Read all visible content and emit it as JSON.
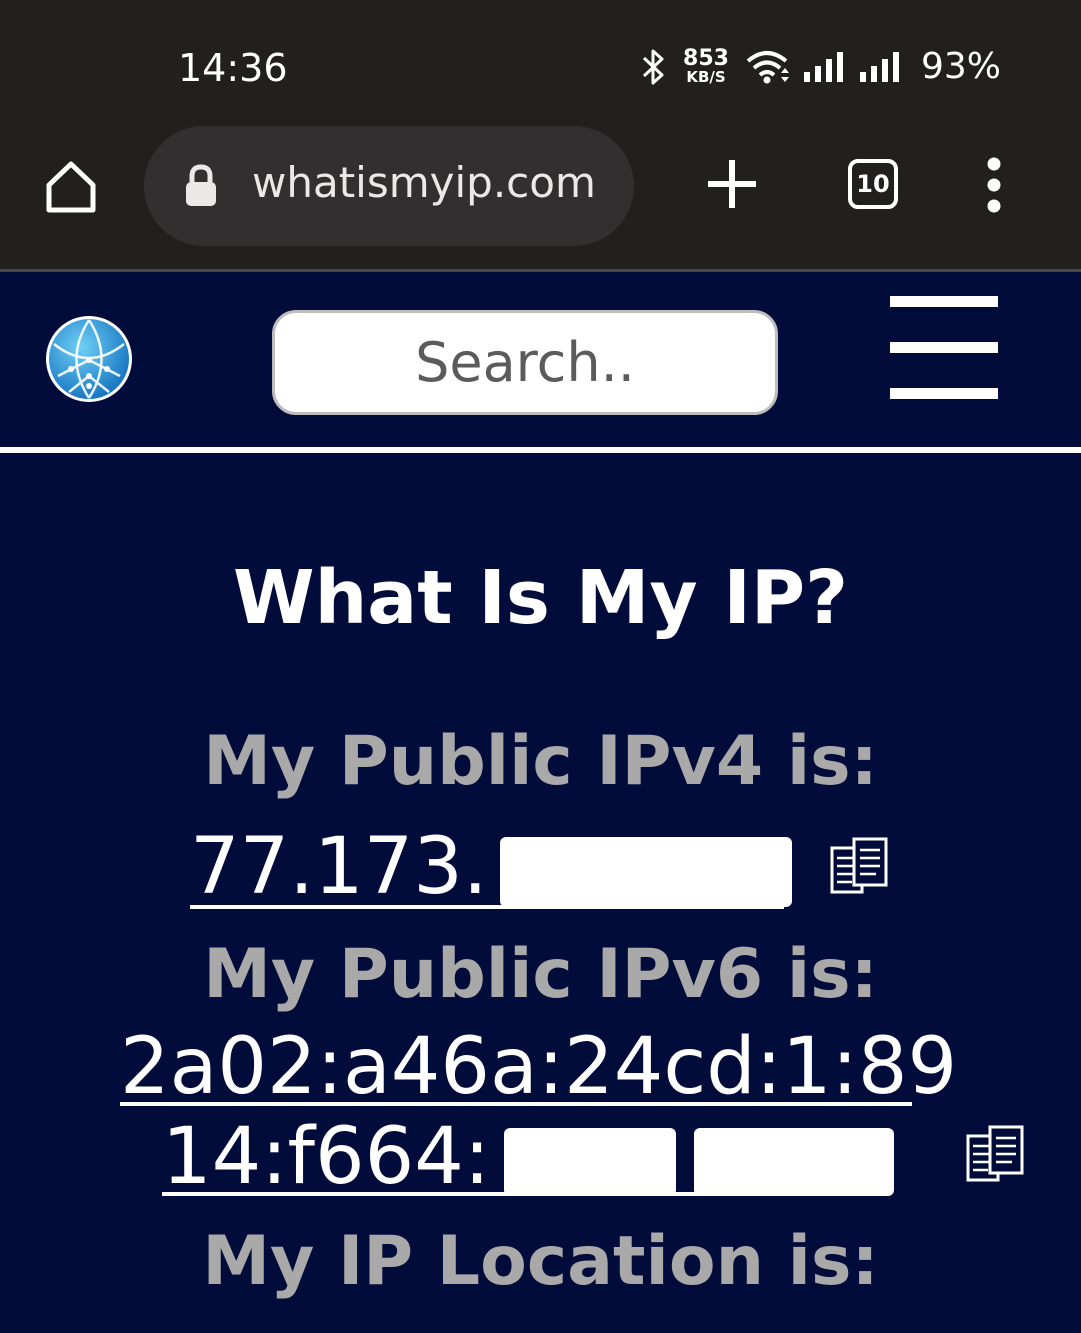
{
  "status_bar": {
    "time": "14:36",
    "speed_value": "853",
    "speed_unit": "KB/S",
    "battery": "93%",
    "icons": [
      "bluetooth-icon",
      "wifi-icon",
      "signal-icon",
      "signal-icon"
    ]
  },
  "browser": {
    "url": "whatismyip.com",
    "tab_count": "10",
    "icons": [
      "home-icon",
      "lock-icon",
      "plus-icon",
      "tabs-icon",
      "more-vert-icon"
    ]
  },
  "site_header": {
    "search_placeholder": "Search..",
    "icons": [
      "globe-logo-icon",
      "hamburger-menu-icon"
    ]
  },
  "main": {
    "title": "What Is My IP?",
    "ipv4_label": "My Public IPv4 is:",
    "ipv4_visible": "77.173.",
    "ipv6_label": "My Public IPv6 is:",
    "ipv6_line1": "2a02:a46a:24cd:1:89",
    "ipv6_line2_visible": "14:f664:",
    "location_label": "My IP Location is:"
  },
  "colors": {
    "site_background": "#020c3a",
    "browser_chrome": "#221f1f",
    "url_bar": "#332f30",
    "label_gray": "#a9a9a9"
  }
}
